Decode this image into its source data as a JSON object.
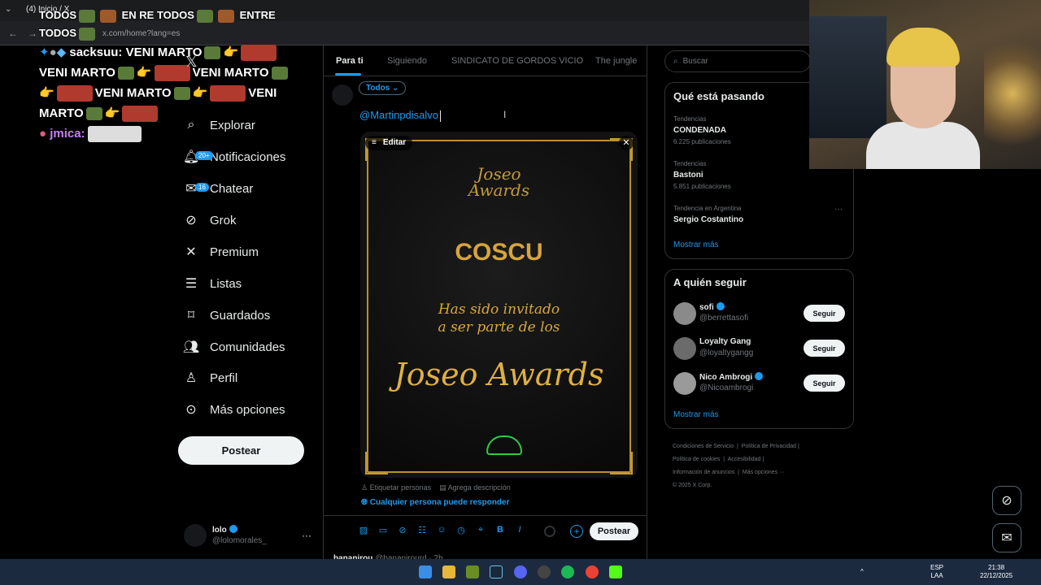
{
  "browser": {
    "tab_title": "(4) Inicio / X",
    "url": "x.com/home?lang=es"
  },
  "chat": {
    "line1": "TODOS",
    "line1b": "EN RE TODOS",
    "line1c": "ENTRE",
    "line2": "TODOS",
    "msg_user": "sacksuu:",
    "msg_text1": "VENI MARTO",
    "msg_text2": "VENI MARTO",
    "msg_text3": "VENI MARTO",
    "msg_text4": "VENI MARTO",
    "msg_text5": "VENI",
    "msg_text6": "MARTO",
    "msg_user2": "jmica:"
  },
  "nav": {
    "items": [
      {
        "label": "Explorar",
        "icon": "search-icon"
      },
      {
        "label": "Notificaciones",
        "icon": "bell-icon",
        "badge": "20+"
      },
      {
        "label": "Chatear",
        "icon": "mail-icon",
        "badge": "16"
      },
      {
        "label": "Grok",
        "icon": "grok-icon"
      },
      {
        "label": "Premium",
        "icon": "x-logo-icon"
      },
      {
        "label": "Listas",
        "icon": "list-icon"
      },
      {
        "label": "Guardados",
        "icon": "bookmark-icon"
      },
      {
        "label": "Comunidades",
        "icon": "people-icon"
      },
      {
        "label": "Perfil",
        "icon": "person-icon"
      },
      {
        "label": "Más opciones",
        "icon": "more-circle-icon"
      }
    ],
    "post_button": "Postear"
  },
  "account": {
    "name": "lolo",
    "handle": "@lolomorales_",
    "more": "···"
  },
  "timeline": {
    "tabs": [
      "Para ti",
      "Siguiendo",
      "SINDICATO DE GORDOS VICIO",
      "The jungle"
    ],
    "active_tab": "Para ti"
  },
  "composer": {
    "audience": "Todos",
    "text": "@Martinpdisalvo",
    "media_edit": "Editar",
    "media_image": {
      "logo_line1": "Joseo",
      "logo_line2": "Awards",
      "name": "COSCU",
      "invite_line1": "Has sido invitado",
      "invite_line2": "a ser parte de los",
      "script_title": "Joseo Awards"
    },
    "tag_people": "Etiquetar personas",
    "add_description": "Agrega descripción",
    "reply_setting": "Cualquier persona puede responder",
    "post_button": "Postear"
  },
  "next_post": {
    "user": "bananirou",
    "handle": "@bananirourd · 2h"
  },
  "search": {
    "placeholder": "Buscar"
  },
  "trends": {
    "title": "Qué está pasando",
    "items": [
      {
        "meta": "Tendencias",
        "name": "CONDENADA",
        "count": "6.225 publicaciones"
      },
      {
        "meta": "Tendencias",
        "name": "Bastoni",
        "count": "5.851 publicaciones"
      },
      {
        "meta": "Tendencia en Argentina",
        "name": "Sergio Costantino",
        "count": ""
      }
    ],
    "show_more": "Mostrar más"
  },
  "who_to_follow": {
    "title": "A quién seguir",
    "items": [
      {
        "name": "sofi",
        "handle": "@berrettasofi",
        "button": "Seguir",
        "verified": true
      },
      {
        "name": "Loyalty Gang",
        "handle": "@loyaltygangg",
        "button": "Seguir",
        "verified": false
      },
      {
        "name": "Nico Ambrogi",
        "handle": "@Nicoambrogi",
        "button": "Seguir",
        "verified": true
      }
    ],
    "show_more": "Mostrar más"
  },
  "footer": {
    "links": [
      "Condiciones de Servicio",
      "Política de Privacidad",
      "Política de cookies",
      "Accesibilidad",
      "Información de anuncios",
      "Más opciones ···",
      "© 2025 X Corp."
    ]
  },
  "taskbar": {
    "lang1": "ESP",
    "lang2": "LAA",
    "time": "21:38",
    "date": "22/12/2025"
  },
  "colors": {
    "accent": "#1d9bf0",
    "gold": "#c49a3a",
    "background": "#000000"
  }
}
